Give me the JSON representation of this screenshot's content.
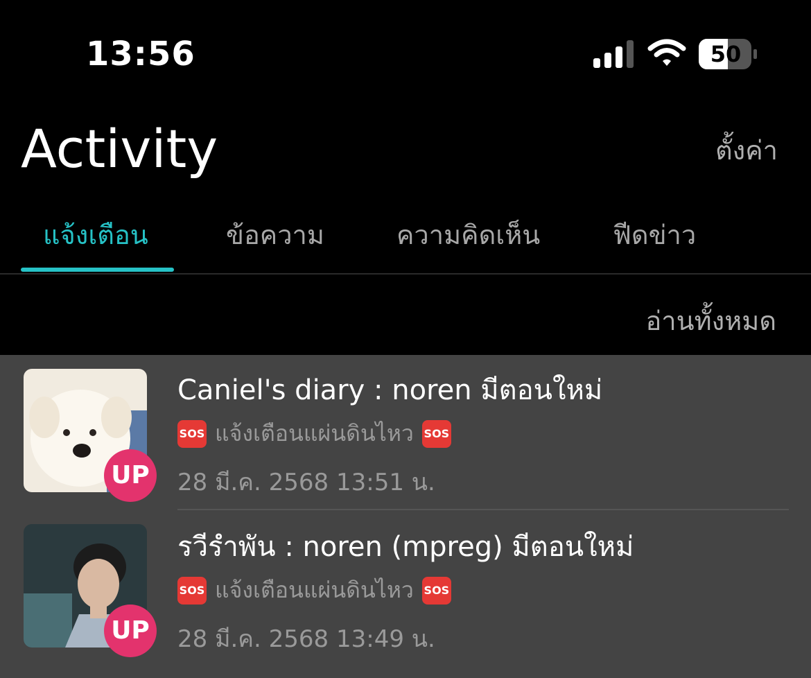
{
  "status_bar": {
    "time": "13:56",
    "battery": "50"
  },
  "header": {
    "title": "Activity",
    "settings_label": "ตั้งค่า"
  },
  "tabs": [
    {
      "label": "แจ้งเตือน",
      "active": true
    },
    {
      "label": "ข้อความ",
      "active": false
    },
    {
      "label": "ความคิดเห็น",
      "active": false
    },
    {
      "label": "ฟีดข่าว",
      "active": false
    }
  ],
  "read_all_label": "อ่านทั้งหมด",
  "notifications": [
    {
      "title": "Caniel's diary : noren  มีตอนใหม่",
      "badge": "UP",
      "sos_label": "SOS",
      "message": "แจ้งเตือนแผ่นดินไหว",
      "time": "28 มี.ค. 2568 13:51 น."
    },
    {
      "title": "รวีรำพัน : noren (mpreg) มีตอนใหม่",
      "badge": "UP",
      "sos_label": "SOS",
      "message": "แจ้งเตือนแผ่นดินไหว",
      "time": "28 มี.ค. 2568 13:49 น."
    }
  ],
  "colors": {
    "accent": "#26c2c6",
    "badge": "#e3336d",
    "sos": "#e53935",
    "list_bg": "#444444"
  }
}
